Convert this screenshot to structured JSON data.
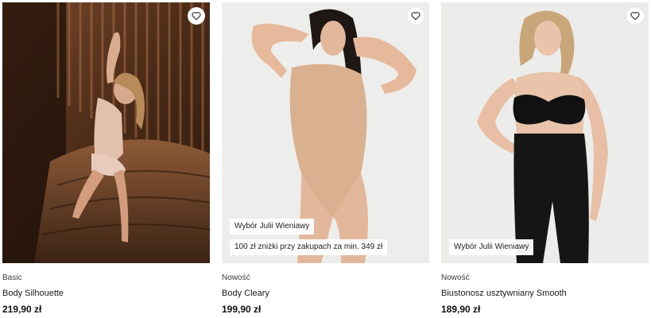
{
  "products": [
    {
      "tag": "Basic",
      "name": "Body Silhouette",
      "price": "219,90 zł",
      "badges": []
    },
    {
      "tag": "Nowość",
      "name": "Body Cleary",
      "price": "199,90 zł",
      "badges": [
        "Wybór Julii Wieniawy",
        "100 zł zniżki przy zakupach za min. 349 zł"
      ]
    },
    {
      "tag": "Nowość",
      "name": "Biustonosz usztywniany Smooth",
      "price": "189,90 zł",
      "badges": [
        "Wybór Julii Wieniawy"
      ]
    }
  ],
  "icons": {
    "favorite": "heart-outline-icon"
  },
  "colors": {
    "text": "#1a1a1a",
    "badge_bg": "#ffffff",
    "price": "#111111"
  }
}
